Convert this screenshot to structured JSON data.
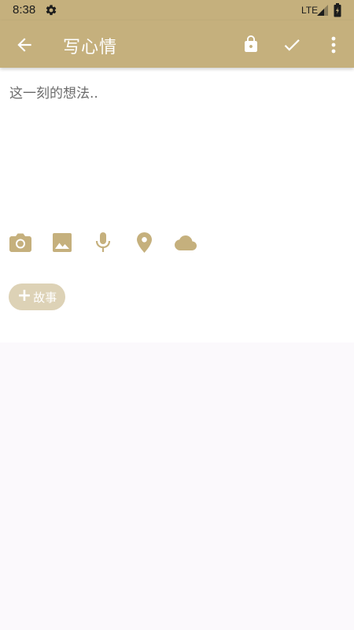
{
  "status_bar": {
    "time": "8:38",
    "network": "LTE",
    "icons": [
      "gear-icon",
      "signal-icon",
      "battery-icon"
    ]
  },
  "app_bar": {
    "title": "写心情",
    "icons": [
      "arrow-back-icon",
      "lock-icon",
      "check-icon",
      "more-vert-icon"
    ]
  },
  "editor": {
    "placeholder": "这一刻的想法..",
    "value": ""
  },
  "toolbar": {
    "icons": [
      "camera-icon",
      "image-icon",
      "mic-icon",
      "location-icon",
      "cloud-icon"
    ]
  },
  "story_chip": {
    "plus": "+",
    "label": "故事"
  },
  "colors": {
    "primary": "#c5b07d",
    "icon_tint": "#c5b07d",
    "chip_bg": "#ddd2b6",
    "page_bg": "#fbf9fc",
    "content_bg": "#ffffff"
  }
}
